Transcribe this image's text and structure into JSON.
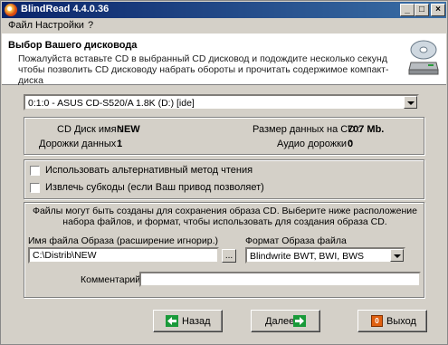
{
  "window": {
    "title": "BlindRead 4.4.0.36",
    "minimize_glyph": "_",
    "maximize_glyph": "□",
    "close_glyph": "×"
  },
  "menu": {
    "items": [
      "Файл",
      "Настройки",
      "?"
    ]
  },
  "header": {
    "title": "Выбор  Вашего дисковода",
    "description": "Пожалуйста вставьте CD в выбранный CD дисковод и подождите несколько секунд чтобы позволить CD дисководу набрать обороты и прочитать содержимое компакт-диска"
  },
  "drive": {
    "selected": "0:1:0 - ASUS CD-S520/A 1.8K (D:) [ide]"
  },
  "cd_info": {
    "disc_name_label": "CD Диск имя :",
    "disc_name_value": "NEW",
    "data_size_label": "Размер данных на CD :",
    "data_size_value": "707 Mb.",
    "data_tracks_label": "Дорожки данных :",
    "data_tracks_value": "1",
    "audio_tracks_label": "Аудио дорожки :",
    "audio_tracks_value": "0"
  },
  "options": {
    "alt_read_label": "Использовать альтернативный метод чтения",
    "extract_subcodes_label": "Извлечь субкоды (если Ваш привод позволяет)"
  },
  "image": {
    "info_text": "Файлы могут быть созданы для сохранения образа CD. Выберите ниже расположение набора файлов, и формат, чтобы использовать для создания образа CD.",
    "filename_label": "Имя файла Образа (расширение игнорир.)",
    "filename_value": "C:\\Distrib\\NEW",
    "browse_label": "...",
    "format_label": "Формат Образа файла",
    "format_value": "Blindwrite BWT, BWI, BWS",
    "comment_label": "Комментарий :",
    "comment_value": ""
  },
  "buttons": {
    "back": "Назад",
    "next": "Далее",
    "exit": "Выход"
  },
  "colors": {
    "titlebar_start": "#0a246a",
    "titlebar_end": "#3a6ea5",
    "face": "#d4d0c8",
    "arrow_green": "#1a9a3a"
  }
}
